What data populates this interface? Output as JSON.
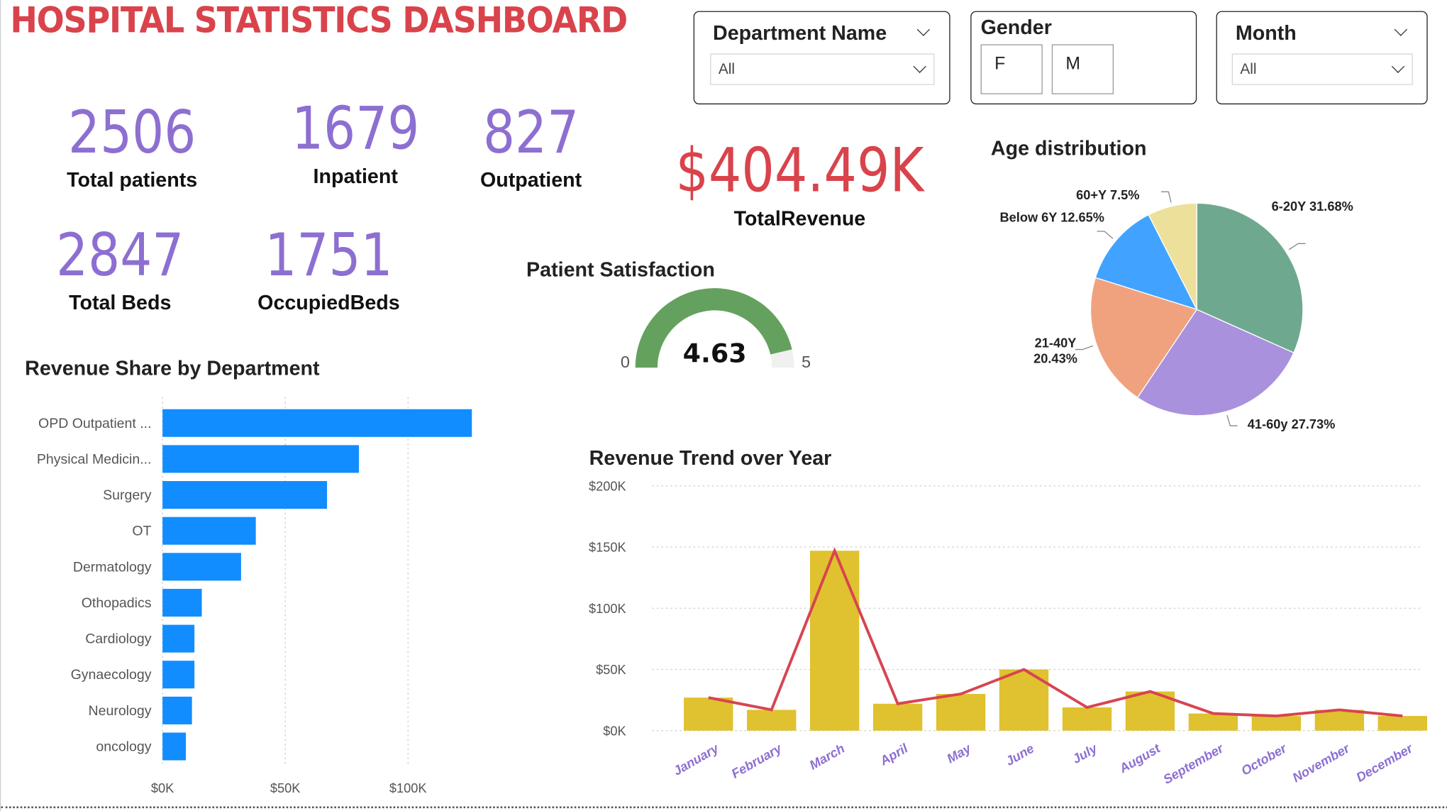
{
  "header": {
    "title": "HOSPITAL STATISTICS DASHBOARD"
  },
  "kpis": {
    "total_patients": {
      "value": "2506",
      "label": "Total patients"
    },
    "inpatient": {
      "value": "1679",
      "label": "Inpatient"
    },
    "outpatient": {
      "value": "827",
      "label": "Outpatient"
    },
    "total_beds": {
      "value": "2847",
      "label": "Total Beds"
    },
    "occupied_beds": {
      "value": "1751",
      "label": "OccupiedBeds"
    },
    "total_revenue": {
      "value": "$404.49K",
      "label": "TotalRevenue"
    }
  },
  "filters": {
    "department": {
      "title": "Department Name",
      "selected": "All"
    },
    "gender": {
      "title": "Gender",
      "options": [
        "F",
        "M"
      ]
    },
    "month": {
      "title": "Month",
      "selected": "All"
    }
  },
  "satisfaction": {
    "title": "Patient Satisfaction",
    "value": 4.63,
    "value_label": "4.63",
    "min": 0,
    "max": 5,
    "min_label": "0",
    "max_label": "5"
  },
  "colors": {
    "accent_red": "#d9434b",
    "kpi_purple": "#8d6fd1",
    "bar_blue": "#118dff",
    "trend_bar": "#e0c12f",
    "trend_line": "#d64550",
    "gauge_green": "#65a15e"
  },
  "chart_data": [
    {
      "type": "bar",
      "orientation": "horizontal",
      "title": "Revenue Share by Department",
      "categories": [
        "OPD Outpatient ...",
        "Physical Medicin...",
        "Surgery",
        "OT",
        "Dermatology",
        "Othopadics",
        "Cardiology",
        "Gynaecology",
        "Neurology",
        "oncology"
      ],
      "values": [
        126000,
        80000,
        67000,
        38000,
        32000,
        16000,
        13000,
        13000,
        12000,
        9500
      ],
      "xlim": [
        0,
        130000
      ],
      "xticks": [
        "$0K",
        "$50K",
        "$100K"
      ],
      "grid": true
    },
    {
      "type": "pie",
      "title": "Age distribution",
      "slices": [
        {
          "label": "6-20Y 31.68%",
          "value": 31.68,
          "color": "#6ea98f"
        },
        {
          "label": "41-60y 27.73%",
          "value": 27.73,
          "color": "#a991de"
        },
        {
          "label": "21-40Y 20.43%",
          "label_lines": [
            "21-40Y",
            "20.43%"
          ],
          "value": 20.43,
          "color": "#f0a27f"
        },
        {
          "label": "Below 6Y 12.65%",
          "value": 12.65,
          "color": "#41a3ff"
        },
        {
          "label": "60+Y 7.5%",
          "value": 7.5,
          "color": "#ece09b"
        }
      ]
    },
    {
      "type": "bar",
      "combo_line": true,
      "title": "Revenue Trend over Year",
      "categories": [
        "January",
        "February",
        "March",
        "April",
        "May",
        "June",
        "July",
        "August",
        "September",
        "October",
        "November",
        "December"
      ],
      "series": [
        {
          "kind": "bar",
          "values": [
            27000,
            17000,
            147000,
            22000,
            30000,
            50000,
            19000,
            32000,
            14000,
            12000,
            17000,
            12000
          ]
        },
        {
          "kind": "line",
          "values": [
            27000,
            17000,
            147000,
            22000,
            30000,
            50000,
            19000,
            32000,
            14000,
            12000,
            17000,
            12000
          ]
        }
      ],
      "ylim": [
        0,
        200000
      ],
      "yticks": [
        "$0K",
        "$50K",
        "$100K",
        "$150K",
        "$200K"
      ],
      "grid": true
    }
  ]
}
